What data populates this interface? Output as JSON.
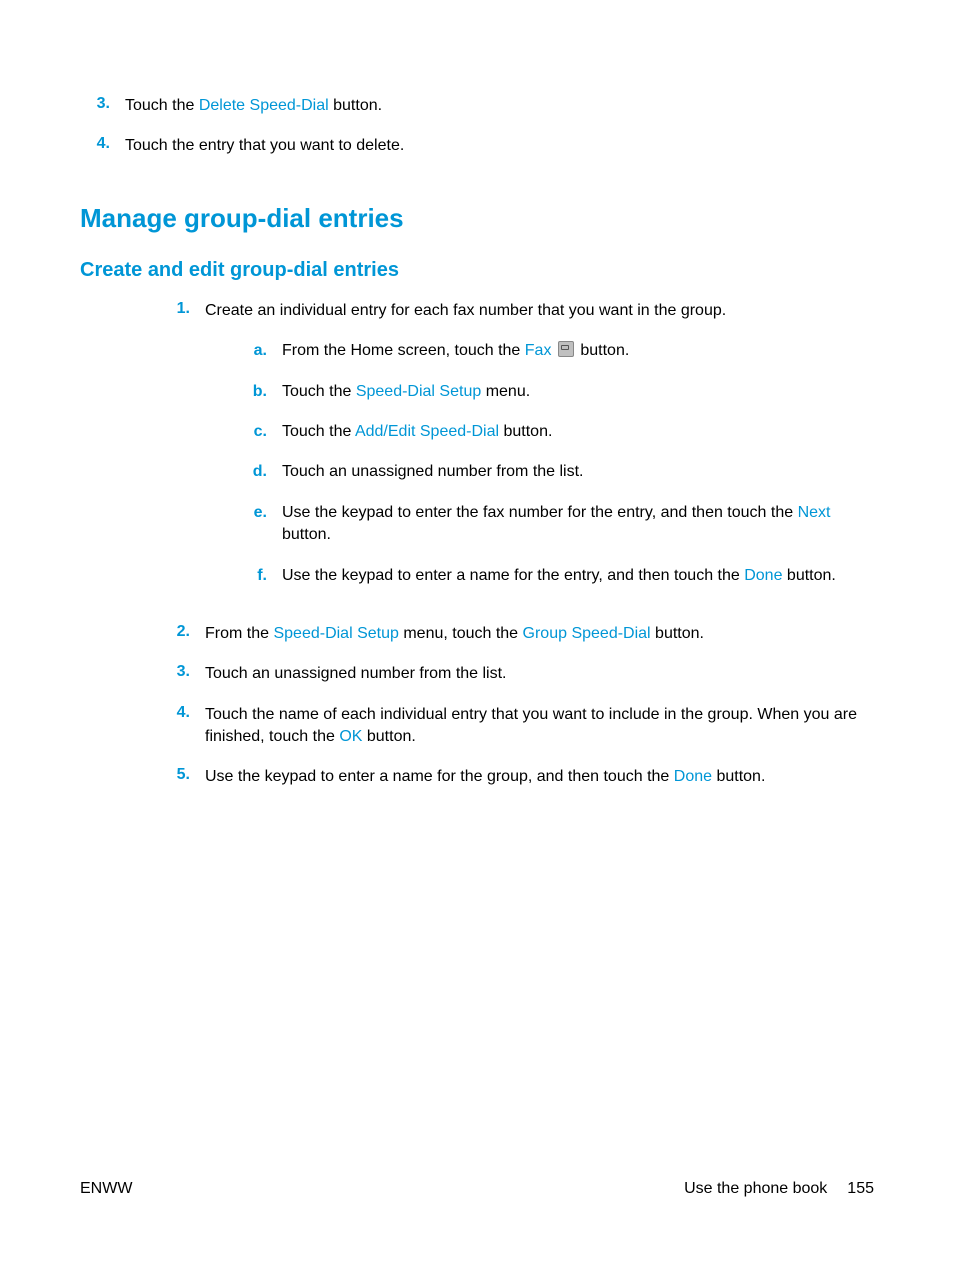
{
  "topList": [
    {
      "marker": "3.",
      "before": "Touch the ",
      "link": "Delete Speed-Dial",
      "after": " button."
    },
    {
      "marker": "4.",
      "before": "Touch the entry that you want to delete.",
      "link": "",
      "after": ""
    }
  ],
  "heading_main": "Manage group-dial entries",
  "heading_sub": "Create and edit group-dial entries",
  "step1": {
    "marker": "1.",
    "text": "Create an individual entry for each fax number that you want in the group.",
    "sub": [
      {
        "marker": "a.",
        "before": "From the Home screen, touch the ",
        "link": "Fax",
        "icon": true,
        "after": " button."
      },
      {
        "marker": "b.",
        "before": "Touch the ",
        "link": "Speed-Dial Setup",
        "after": " menu."
      },
      {
        "marker": "c.",
        "before": "Touch the ",
        "link": "Add/Edit Speed-Dial",
        "after": " button."
      },
      {
        "marker": "d.",
        "before": "Touch an unassigned number from the list.",
        "link": "",
        "after": ""
      },
      {
        "marker": "e.",
        "before": "Use the keypad to enter the fax number for the entry, and then touch the ",
        "link": "Next",
        "after": " button."
      },
      {
        "marker": "f.",
        "before": "Use the keypad to enter a name for the entry, and then touch the ",
        "link": "Done",
        "after": " button."
      }
    ]
  },
  "step2": {
    "marker": "2.",
    "before": "From the ",
    "link1": "Speed-Dial Setup",
    "mid": " menu, touch the ",
    "link2": "Group Speed-Dial",
    "after": " button."
  },
  "step3": {
    "marker": "3.",
    "text": "Touch an unassigned number from the list."
  },
  "step4": {
    "marker": "4.",
    "before": "Touch the name of each individual entry that you want to include in the group. When you are finished, touch the ",
    "link": "OK",
    "after": " button."
  },
  "step5": {
    "marker": "5.",
    "before": "Use the keypad to enter a name for the group, and then touch the ",
    "link": "Done",
    "after": " button."
  },
  "footer": {
    "left": "ENWW",
    "right": "Use the phone book",
    "page": "155"
  }
}
